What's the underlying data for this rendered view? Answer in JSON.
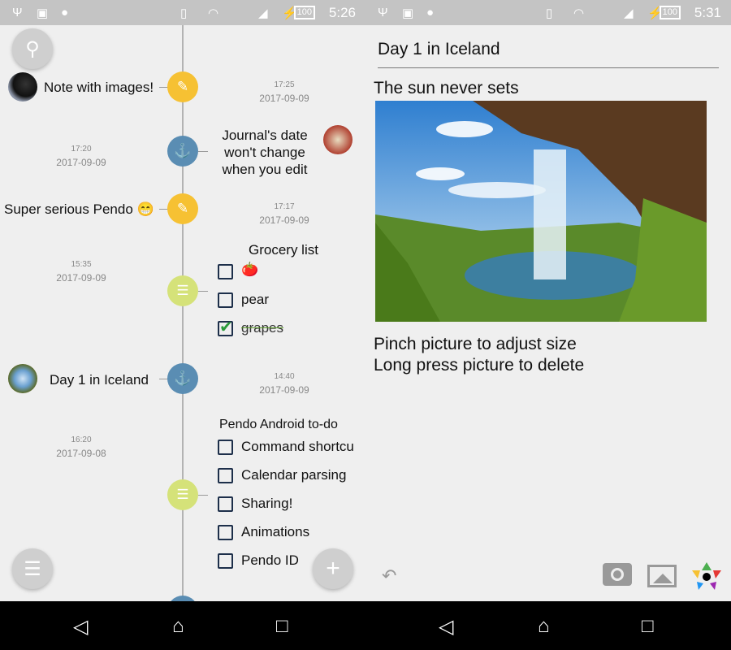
{
  "left": {
    "status": {
      "time": "5:26",
      "battery": "100"
    },
    "entries": [
      {
        "title": "Note with images!",
        "time": "17:25",
        "date": "2017-09-09",
        "type": "note",
        "color": "#f6c133"
      },
      {
        "title": "Journal's date won't change when you edit",
        "time": "17:20",
        "date": "2017-09-09",
        "type": "journal",
        "color": "#5a8db3"
      },
      {
        "title": "Super serious Pendo 😁",
        "time": "17:17",
        "date": "2017-09-09",
        "type": "note",
        "color": "#f6c133"
      },
      {
        "title": "Grocery list",
        "time": "15:35",
        "date": "2017-09-09",
        "type": "checklist",
        "color": "#d5e279",
        "items": [
          {
            "label": "🍅",
            "checked": false
          },
          {
            "label": "pear",
            "checked": false
          },
          {
            "label": "grapes",
            "checked": true
          }
        ]
      },
      {
        "title": "Day 1 in Iceland",
        "time": "14:40",
        "date": "2017-09-09",
        "type": "journal",
        "color": "#5a8db3"
      },
      {
        "title": "Pendo Android to-do",
        "time": "16:20",
        "date": "2017-09-08",
        "type": "checklist",
        "color": "#d5e279",
        "items": [
          {
            "label": "Command shortcu",
            "checked": false
          },
          {
            "label": "Calendar parsing",
            "checked": false
          },
          {
            "label": "Sharing!",
            "checked": false
          },
          {
            "label": "Animations",
            "checked": false
          },
          {
            "label": "Pendo ID",
            "checked": false
          }
        ]
      }
    ]
  },
  "right": {
    "status": {
      "time": "5:31",
      "battery": "100"
    },
    "title": "Day 1 in Iceland",
    "heading": "The sun never sets",
    "hint1": "Pinch picture to adjust size",
    "hint2": "Long press picture to delete"
  },
  "icons": {
    "search": "search-icon",
    "menu": "menu-icon",
    "add": "plus-icon",
    "undo": "undo-icon",
    "camera": "camera-icon",
    "image": "image-icon",
    "palette": "color-star-icon"
  }
}
